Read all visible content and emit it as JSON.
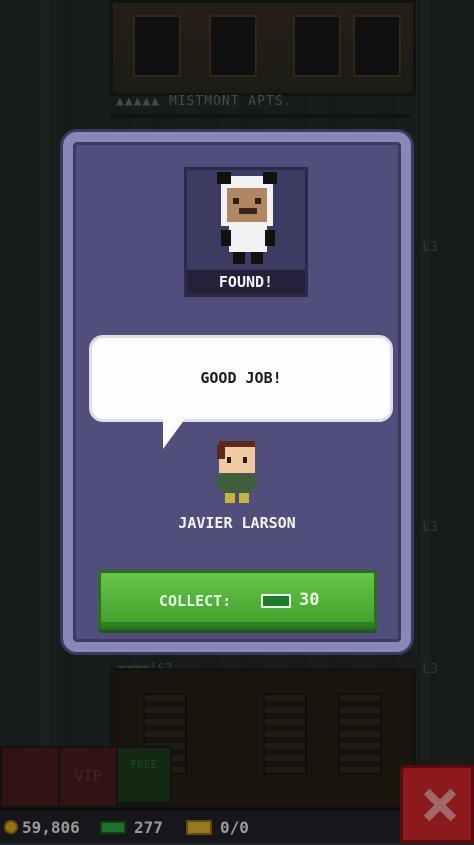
{
  "background": {
    "floor_name": "▲▲▲▲▲ MISTMONT APTS.",
    "floor_stat": "▼▼▼▼163",
    "level_tags": [
      "L3",
      "L3",
      "L3"
    ],
    "tabs": {
      "vip": "VIP",
      "free": "FREE"
    }
  },
  "status_bar": {
    "coins": "59,806",
    "bux": "277",
    "tickets": "0/0"
  },
  "modal": {
    "found_label": "FOUND!",
    "speech": "GOOD JOB!",
    "character_name": "JAVIER LARSON",
    "collect_label": "COLLECT:",
    "collect_amount": "30"
  },
  "colors": {
    "modal_bg": "#514e7c",
    "modal_border": "#8a86b8",
    "collect_green": "#4fb03a",
    "close_red": "#d7282b",
    "coin_gold": "#e8b21a",
    "bux_green": "#2fae43"
  },
  "icons": [
    "coin-icon",
    "bux-icon",
    "ticket-icon",
    "close-icon",
    "elevator-arrows-icon"
  ]
}
